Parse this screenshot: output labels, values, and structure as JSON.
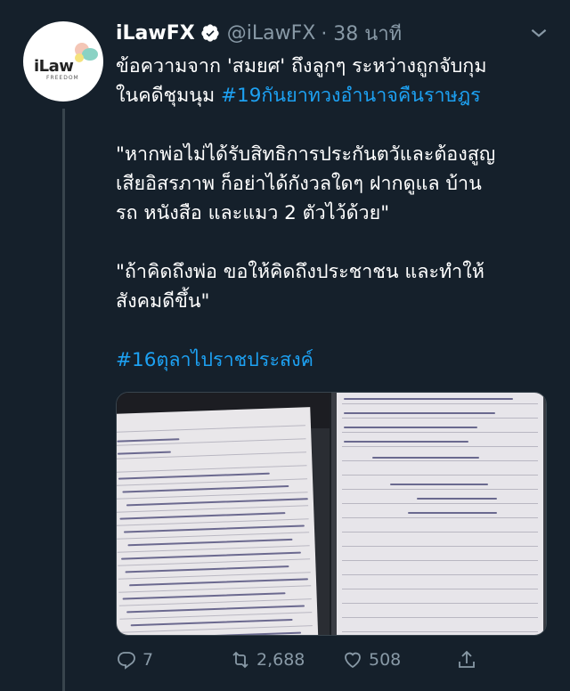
{
  "tweet": {
    "author_name": "iLawFX",
    "handle": "@iLawFX",
    "timestamp": "· 38 นาที",
    "avatar_text": "iLaw",
    "avatar_subtext": "FREEDOM",
    "lines": [
      "ข้อความจาก 'สมยศ' ถึงลูกๆ ระหว่างถูกจับกุม",
      "ในคดีชุมนุม "
    ],
    "hashtag_1": "#19กันยาทวงอำนาจคืนราษฎร",
    "quote_1_lines": [
      "\"หากพ่อไม่ได้รับสิทธิการประกันตวัและต้องสูญ",
      "เสียอิสรภาพ ก็อย่าได้กังวลใดๆ ฝากดูแล บ้าน",
      "รถ หนังสือ และแมว 2 ตัวไว้ด้วย\""
    ],
    "quote_2_lines": [
      "\"ถ้าคิดถึงพ่อ ขอให้คิดถึงประชาชน และทำให้",
      "สังคมดีขึ้น\""
    ],
    "hashtag_2": "#16ตุลาไปราชประสงค์"
  },
  "stats": {
    "replies": "7",
    "retweets": "2,688",
    "likes": "508"
  },
  "icons": {
    "verified": "verified-badge-icon",
    "more": "chevron-down-icon",
    "reply": "reply-icon",
    "retweet": "retweet-icon",
    "like": "heart-icon",
    "share": "share-icon"
  },
  "colors": {
    "background": "#15202b",
    "link": "#1da1f2",
    "secondary_text": "#8899a6"
  }
}
